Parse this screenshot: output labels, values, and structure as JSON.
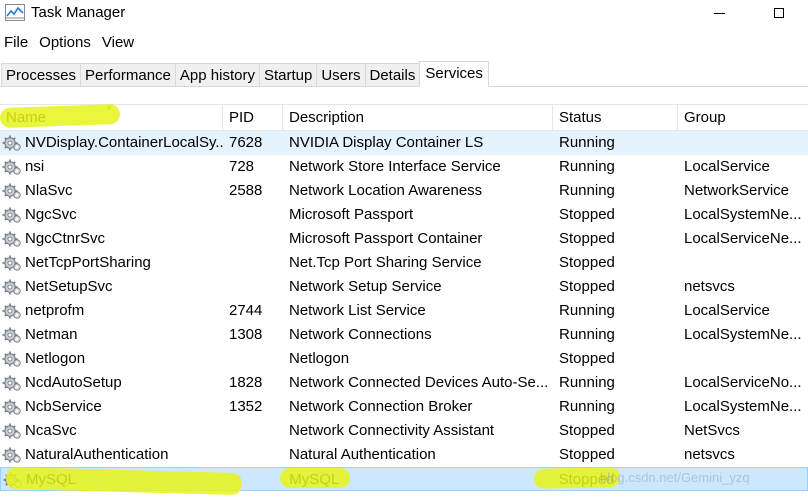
{
  "window": {
    "title": "Task Manager",
    "icon": "task-manager-icon",
    "minimize_glyph": "minimize",
    "maximize_glyph": "maximize"
  },
  "menu": [
    "File",
    "Options",
    "View"
  ],
  "tabs": [
    {
      "label": "Processes",
      "active": false
    },
    {
      "label": "Performance",
      "active": false
    },
    {
      "label": "App history",
      "active": false
    },
    {
      "label": "Startup",
      "active": false
    },
    {
      "label": "Users",
      "active": false
    },
    {
      "label": "Details",
      "active": false
    },
    {
      "label": "Services",
      "active": true
    }
  ],
  "columns": {
    "name": "Name",
    "pid": "PID",
    "description": "Description",
    "status": "Status",
    "group": "Group"
  },
  "rows": [
    {
      "name": "NVDisplay.ContainerLocalSy...",
      "pid": "7628",
      "description": "NVIDIA Display Container LS",
      "status": "Running",
      "group": "",
      "state": "hover"
    },
    {
      "name": "nsi",
      "pid": "728",
      "description": "Network Store Interface Service",
      "status": "Running",
      "group": "LocalService",
      "state": ""
    },
    {
      "name": "NlaSvc",
      "pid": "2588",
      "description": "Network Location Awareness",
      "status": "Running",
      "group": "NetworkService",
      "state": ""
    },
    {
      "name": "NgcSvc",
      "pid": "",
      "description": "Microsoft Passport",
      "status": "Stopped",
      "group": "LocalSystemNe...",
      "state": ""
    },
    {
      "name": "NgcCtnrSvc",
      "pid": "",
      "description": "Microsoft Passport Container",
      "status": "Stopped",
      "group": "LocalServiceNe...",
      "state": ""
    },
    {
      "name": "NetTcpPortSharing",
      "pid": "",
      "description": "Net.Tcp Port Sharing Service",
      "status": "Stopped",
      "group": "",
      "state": ""
    },
    {
      "name": "NetSetupSvc",
      "pid": "",
      "description": "Network Setup Service",
      "status": "Stopped",
      "group": "netsvcs",
      "state": ""
    },
    {
      "name": "netprofm",
      "pid": "2744",
      "description": "Network List Service",
      "status": "Running",
      "group": "LocalService",
      "state": ""
    },
    {
      "name": "Netman",
      "pid": "1308",
      "description": "Network Connections",
      "status": "Running",
      "group": "LocalSystemNe...",
      "state": ""
    },
    {
      "name": "Netlogon",
      "pid": "",
      "description": "Netlogon",
      "status": "Stopped",
      "group": "",
      "state": ""
    },
    {
      "name": "NcdAutoSetup",
      "pid": "1828",
      "description": "Network Connected Devices Auto-Se...",
      "status": "Running",
      "group": "LocalServiceNo...",
      "state": ""
    },
    {
      "name": "NcbService",
      "pid": "1352",
      "description": "Network Connection Broker",
      "status": "Running",
      "group": "LocalSystemNe...",
      "state": ""
    },
    {
      "name": "NcaSvc",
      "pid": "",
      "description": "Network Connectivity Assistant",
      "status": "Stopped",
      "group": "NetSvcs",
      "state": ""
    },
    {
      "name": "NaturalAuthentication",
      "pid": "",
      "description": "Natural Authentication",
      "status": "Stopped",
      "group": "netsvcs",
      "state": ""
    },
    {
      "name": "MySQL",
      "pid": "",
      "description": "MySQL",
      "status": "Stopped",
      "group": "",
      "state": "selected"
    }
  ],
  "row_icon": "service-gear-icon",
  "watermark": "blog.csdn.net/Gemini_yzq",
  "colors": {
    "highlighter": "#e6f51a",
    "hover_row": "#e5f3ff",
    "selected_row": "#cce8ff",
    "chart_line": "#2b7bd6"
  }
}
